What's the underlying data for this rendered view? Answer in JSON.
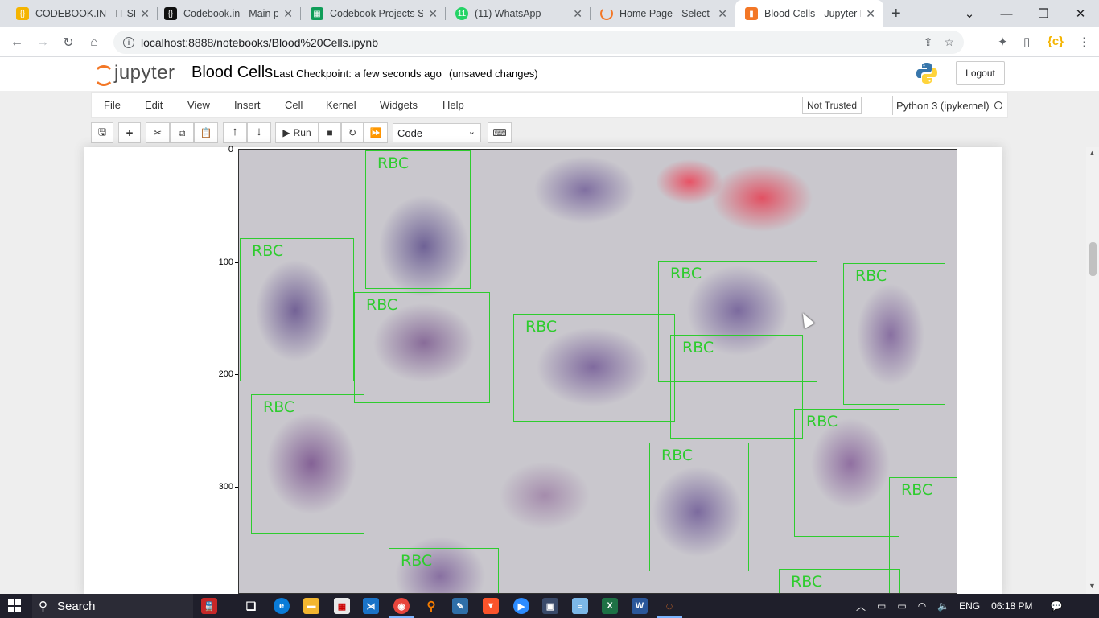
{
  "browser": {
    "tabs": [
      {
        "title": "CODEBOOK.IN - IT SER",
        "icon": "codebook-icon",
        "color": "#f4b400"
      },
      {
        "title": "Codebook.in - Main p",
        "icon": "codebook-dark-icon",
        "color": "#111111"
      },
      {
        "title": "Codebook Projects St",
        "icon": "sheets-icon",
        "color": "#0f9d58"
      },
      {
        "title": "(11) WhatsApp",
        "icon": "whatsapp-icon",
        "color": "#25d366"
      },
      {
        "title": "Home Page - Select o",
        "icon": "loading-icon",
        "color": "#f37726"
      },
      {
        "title": "Blood Cells - Jupyter N",
        "icon": "jupyter-icon",
        "color": "#f37726"
      }
    ],
    "url": "localhost:8888/notebooks/Blood%20Cells.ipynb"
  },
  "jupyter": {
    "logo_text": "jupyter",
    "notebook_name": "Blood Cells",
    "checkpoint": "Last Checkpoint: a few seconds ago",
    "unsaved": "(unsaved changes)",
    "logout": "Logout",
    "menu": [
      "File",
      "Edit",
      "View",
      "Insert",
      "Cell",
      "Kernel",
      "Widgets",
      "Help"
    ],
    "trust": "Not Trusted",
    "kernel": "Python 3 (ipykernel)",
    "toolbar": {
      "run": "Run",
      "cell_type": "Code"
    }
  },
  "plot": {
    "yticks": [
      "0",
      "100",
      "200",
      "300"
    ],
    "box_label": "RBC",
    "box_color": "#2ecc2e"
  },
  "taskbar": {
    "search": "Search",
    "lang": "ENG",
    "time": "06:18 PM"
  }
}
